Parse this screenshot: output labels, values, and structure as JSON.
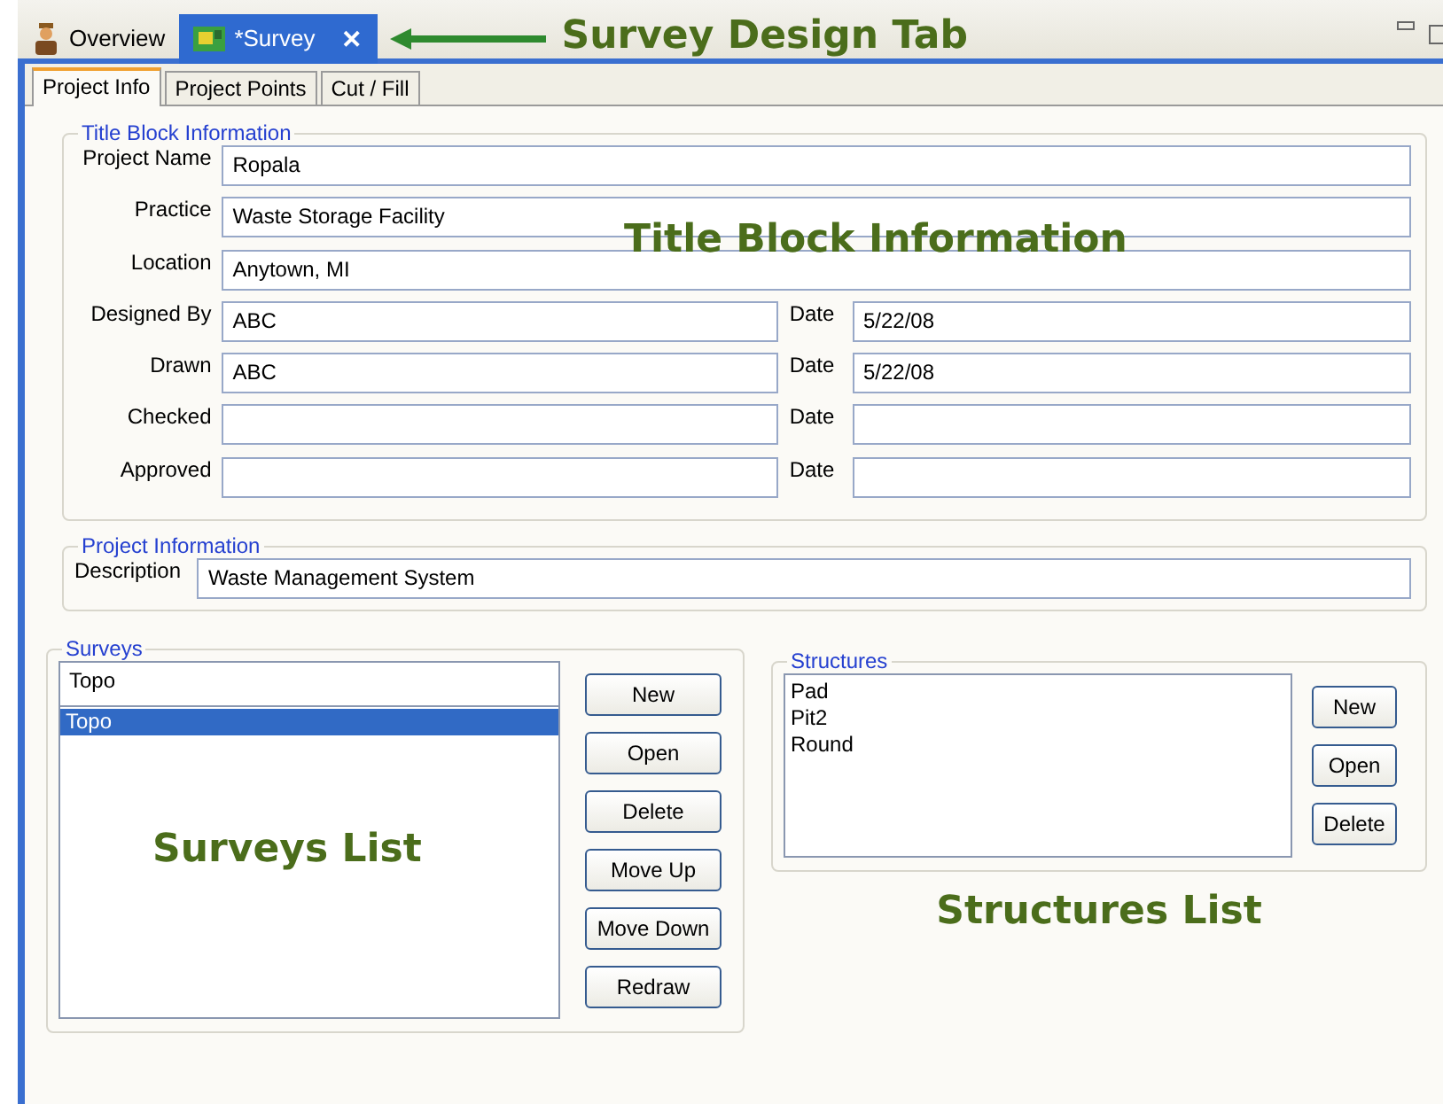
{
  "editor_tabs": [
    {
      "label": "Overview",
      "selected": false
    },
    {
      "label": "*Survey",
      "selected": true,
      "close": "✕"
    }
  ],
  "callout_tab": {
    "text": "Survey Design Tab"
  },
  "tabs": [
    {
      "label": "Project Info",
      "selected": true
    },
    {
      "label": "Project Points",
      "selected": false
    },
    {
      "label": "Cut / Fill",
      "selected": false
    }
  ],
  "title_block": {
    "legend": "Title Block Information",
    "callout": "Title Block Information",
    "rows": [
      {
        "label": "Project Name",
        "value": "Ropala"
      },
      {
        "label": "Practice",
        "value": "Waste Storage Facility"
      },
      {
        "label": "Location",
        "value": "Anytown, MI"
      },
      {
        "label": "Designed By",
        "value": "ABC",
        "date_label": "Date",
        "date": "5/22/08"
      },
      {
        "label": "Drawn",
        "value": "ABC",
        "date_label": "Date",
        "date": "5/22/08"
      },
      {
        "label": "Checked",
        "date_label": "Date"
      },
      {
        "label": "Approved",
        "date_label": "Date"
      }
    ]
  },
  "project_info": {
    "legend": "Project Information",
    "label": "Description",
    "value": "Waste Management System"
  },
  "surveys": {
    "legend": "Surveys",
    "input": "Topo",
    "items": [
      {
        "label": "Topo",
        "selected": true
      }
    ],
    "callout": "Surveys List",
    "buttons": [
      "New",
      "Open",
      "Delete",
      "Move Up",
      "Move Down",
      "Redraw"
    ]
  },
  "structures": {
    "legend": "Structures",
    "items": [
      {
        "label": "Pad",
        "selected": false
      },
      {
        "label": "Pit2",
        "selected": false
      },
      {
        "label": "Round",
        "selected": false
      }
    ],
    "callout": "Structures List",
    "buttons": [
      "New",
      "Open",
      "Delete"
    ]
  }
}
